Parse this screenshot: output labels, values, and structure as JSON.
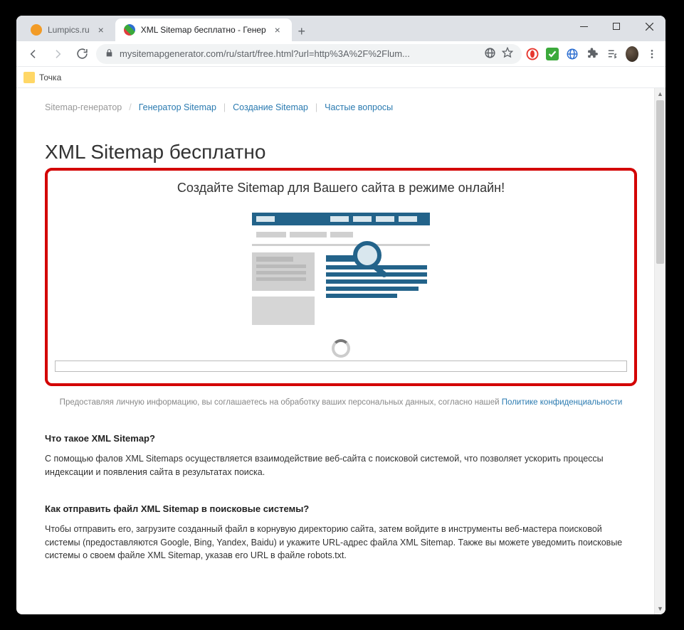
{
  "tabs": [
    {
      "title": "Lumpics.ru",
      "iconColor": "#f29b26",
      "active": false
    },
    {
      "title": "XML Sitemap бесплатно - Генер",
      "iconColor": "#3ba93b",
      "active": true
    }
  ],
  "address": {
    "urlDisplay": "mysitemapgenerator.com/ru/start/free.html?url=http%3A%2F%2Flum..."
  },
  "bookmarks": {
    "item1": "Точка"
  },
  "breadcrumbs": {
    "root": "Sitemap-генератор",
    "item1": "Генератор Sitemap",
    "item2": "Создание Sitemap",
    "item3": "Частые вопросы"
  },
  "page": {
    "h1": "XML Sitemap бесплатно",
    "subhead": "Создайте Sitemap для Вашего сайта в режиме онлайн!",
    "consentPrefix": "Предоставляя личную информацию, вы соглашаетесь на обработку ваших персональных данных, согласно нашей ",
    "consentLink": "Политике конфиденциальности",
    "q1": "Что такое XML Sitemap?",
    "a1": "С помощью фалов XML Sitemaps осуществляется взаимодействие веб-сайта с поисковой системой, что позволяет ускорить процессы индексации и появления сайта в результатах поиска.",
    "q2": "Как отправить файл XML Sitemap в поисковые системы?",
    "a2": "Чтобы отправить его, загрузите созданный файл в корнувую директорию сайта, затем войдите в инструменты веб-мастера поисковой системы (предоставляются Google, Bing, Yandex, Baidu) и укажите URL-адрес файла XML Sitemap. Также вы можете уведомить поисковые системы о своем файле XML Sitemap, указав его URL в файле robots.txt."
  }
}
